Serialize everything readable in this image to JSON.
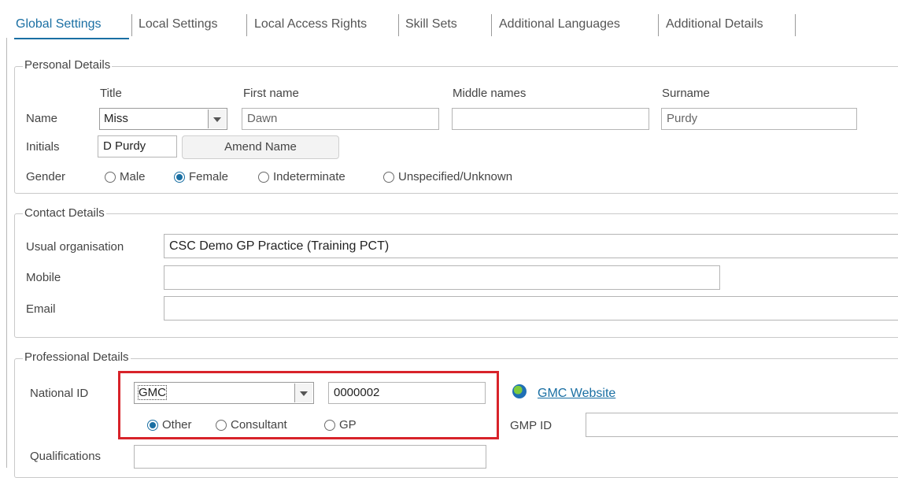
{
  "tabs": [
    {
      "label": "Global Settings",
      "active": true
    },
    {
      "label": "Local Settings"
    },
    {
      "label": "Local Access Rights"
    },
    {
      "label": "Skill Sets"
    },
    {
      "label": "Additional Languages"
    },
    {
      "label": "Additional Details"
    }
  ],
  "personal": {
    "legend": "Personal Details",
    "headers": {
      "title": "Title",
      "first": "First name",
      "middle": "Middle names",
      "surname": "Surname"
    },
    "name_label": "Name",
    "title_value": "Miss",
    "first_value": "Dawn",
    "middle_value": "",
    "surname_value": "Purdy",
    "initials_label": "Initials",
    "initials_value": "D Purdy",
    "amend_button": "Amend Name",
    "gender_label": "Gender",
    "gender_options": [
      "Male",
      "Female",
      "Indeterminate",
      "Unspecified/Unknown"
    ],
    "gender_selected": "Female"
  },
  "contact": {
    "legend": "Contact Details",
    "org_label": "Usual organisation",
    "org_value": "CSC Demo GP Practice (Training PCT)",
    "mobile_label": "Mobile",
    "mobile_value": "",
    "email_label": "Email",
    "email_value": ""
  },
  "professional": {
    "legend": "Professional Details",
    "national_id_label": "National ID",
    "id_type_value": "GMC",
    "id_number_value": "0000002",
    "role_options": [
      "Other",
      "Consultant",
      "GP"
    ],
    "role_selected": "Other",
    "website_link": "GMC Website",
    "gmp_label": "GMP ID",
    "gmp_value": "",
    "qualifications_label": "Qualifications",
    "qualifications_value": ""
  },
  "colors": {
    "accent": "#1a6fa3",
    "highlight": "#d8232a"
  }
}
